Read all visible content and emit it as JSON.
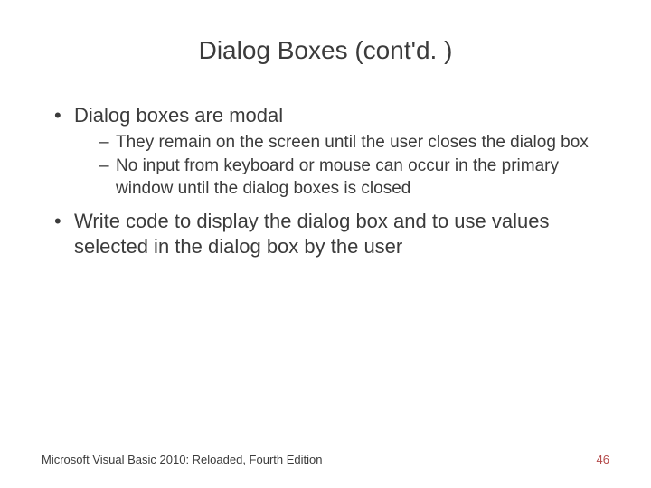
{
  "title": "Dialog Boxes (cont'd. )",
  "bullets": [
    {
      "text": "Dialog boxes are modal",
      "sub": [
        "They remain on the screen until the user closes the dialog box",
        "No input from keyboard or mouse can occur in the primary window until the dialog boxes is closed"
      ]
    },
    {
      "text": "Write code to display the dialog box and to use values selected in the dialog box by the user",
      "sub": []
    }
  ],
  "footer": {
    "left": "Microsoft Visual Basic 2010: Reloaded, Fourth Edition",
    "page": "46"
  }
}
